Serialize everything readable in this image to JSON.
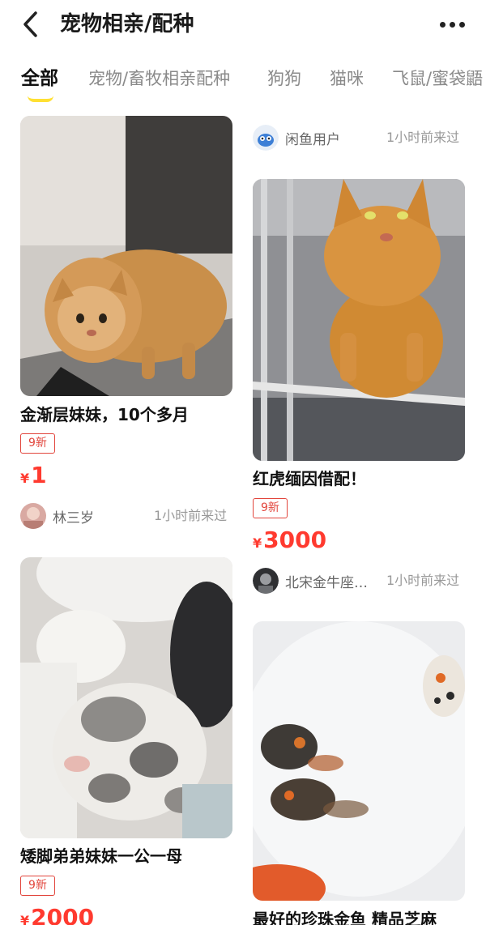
{
  "header": {
    "title": "宠物相亲/配种"
  },
  "tabs": [
    {
      "label": "全部",
      "active": true
    },
    {
      "label": "宠物/畜牧相亲配种",
      "active": false
    },
    {
      "label": "狗狗",
      "active": false
    },
    {
      "label": "猫咪",
      "active": false
    },
    {
      "label": "飞鼠/蜜袋鼯",
      "active": false
    }
  ],
  "feed": {
    "left": [
      {
        "title": "金渐层妹妹，10个多月",
        "condition": "9新",
        "currency": "¥",
        "price": "1",
        "seller": "林三岁",
        "time": "1小时前来过"
      },
      {
        "title": "矮脚弟弟妹妹一公一母",
        "condition": "9新",
        "currency": "¥",
        "price": "2000"
      }
    ],
    "right": [
      {
        "seller": "闲鱼用户",
        "time": "1小时前来过"
      },
      {
        "title": "红虎缅因借配！",
        "condition": "9新",
        "currency": "¥",
        "price": "3000",
        "seller": "北宋金牛座…",
        "time": "1小时前来过"
      },
      {
        "title": "最好的珍珠金鱼 精品芝麻"
      }
    ]
  },
  "colors": {
    "price": "#ff3a2f",
    "badge": "#e2453c",
    "tab_underline": "#ffe033"
  }
}
